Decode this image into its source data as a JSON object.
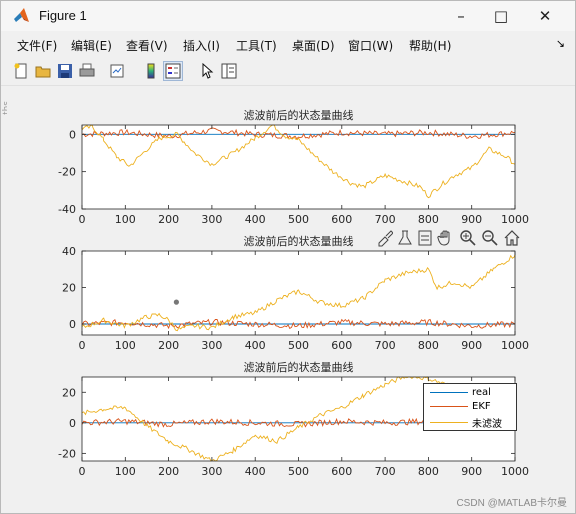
{
  "window": {
    "title": "Figure 1"
  },
  "menu": [
    "文件(F)",
    "编辑(E)",
    "查看(V)",
    "插入(I)",
    "工具(T)",
    "桌面(D)",
    "窗口(W)",
    "帮助(H)"
  ],
  "toolbar_icons": [
    "new-figure-icon",
    "open-folder-icon",
    "save-icon",
    "print-icon",
    "link-plot-icon",
    "insert-colorbar-icon",
    "insert-legend-icon",
    "pointer-icon",
    "property-inspector-icon"
  ],
  "axes_toolbar_icons": [
    "brush-icon",
    "data-tips-icon",
    "pan-hand-icon",
    "zoom-in-icon",
    "zoom-out-icon",
    "home-icon"
  ],
  "watermark": "CSDN @MATLAB卡尔曼",
  "side_fragment": "ths",
  "legend": {
    "entries": [
      "real",
      "EKF",
      "未滤波"
    ],
    "colors": [
      "#0072BD",
      "#D95319",
      "#EDB120"
    ]
  },
  "chart_data": [
    {
      "type": "line",
      "title": "滤波前后的状态量曲线",
      "xlim": [
        0,
        1000
      ],
      "ylim": [
        -40,
        5
      ],
      "xticks": [
        0,
        100,
        200,
        300,
        400,
        500,
        600,
        700,
        800,
        900,
        1000
      ],
      "yticks": [
        0,
        -20,
        -40
      ],
      "series": [
        {
          "name": "real",
          "color": "#0072BD",
          "x": [
            0,
            1000
          ],
          "y": [
            0,
            0
          ]
        },
        {
          "name": "EKF",
          "color": "#D95319",
          "x": [
            0,
            100,
            200,
            300,
            400,
            500,
            600,
            700,
            800,
            900,
            1000
          ],
          "y": [
            0,
            1,
            -1,
            2,
            0,
            -1,
            1,
            0,
            1,
            -1,
            1
          ]
        },
        {
          "name": "未滤波",
          "color": "#EDB120",
          "x": [
            0,
            25,
            50,
            80,
            110,
            150,
            180,
            220,
            260,
            300,
            350,
            400,
            440,
            470,
            500,
            540,
            580,
            620,
            650,
            700,
            740,
            780,
            800,
            830,
            860,
            900,
            940,
            980,
            1000
          ],
          "y": [
            3,
            4,
            -3,
            -12,
            -17,
            -8,
            -2,
            0,
            -10,
            -16,
            -10,
            -2,
            5,
            -1,
            -3,
            -12,
            -20,
            -26,
            -28,
            -22,
            -25,
            -28,
            -33,
            -27,
            -22,
            -18,
            -8,
            -12,
            -16
          ]
        }
      ]
    },
    {
      "type": "line",
      "title": "滤波前后的状态量曲线",
      "xlim": [
        0,
        1000
      ],
      "ylim": [
        -6,
        40
      ],
      "xticks": [
        0,
        100,
        200,
        300,
        400,
        500,
        600,
        700,
        800,
        900,
        1000
      ],
      "yticks": [
        40,
        20,
        0
      ],
      "series": [
        {
          "name": "real",
          "color": "#0072BD",
          "x": [
            0,
            1000
          ],
          "y": [
            0,
            0
          ]
        },
        {
          "name": "EKF",
          "color": "#D95319",
          "x": [
            0,
            100,
            200,
            300,
            400,
            500,
            600,
            700,
            800,
            900,
            1000
          ],
          "y": [
            0,
            1,
            -1,
            1,
            0,
            -1,
            1,
            0,
            1,
            -1,
            0
          ]
        },
        {
          "name": "未滤波",
          "color": "#EDB120",
          "x": [
            0,
            50,
            100,
            150,
            180,
            200,
            220,
            260,
            300,
            350,
            400,
            450,
            500,
            550,
            600,
            650,
            700,
            750,
            800,
            820,
            860,
            900,
            950,
            1000
          ],
          "y": [
            -2,
            2,
            -1,
            4,
            5,
            2,
            -3,
            -1,
            -2,
            4,
            6,
            13,
            18,
            12,
            10,
            14,
            24,
            28,
            30,
            20,
            23,
            20,
            30,
            38
          ]
        }
      ],
      "marker": {
        "x": 218,
        "y": 12
      }
    },
    {
      "type": "line",
      "title": "滤波前后的状态量曲线",
      "xlim": [
        0,
        1000
      ],
      "ylim": [
        -25,
        30
      ],
      "xticks": [
        0,
        100,
        200,
        300,
        400,
        500,
        600,
        700,
        800,
        900,
        1000
      ],
      "yticks": [
        20,
        0,
        -20
      ],
      "series": [
        {
          "name": "real",
          "color": "#0072BD",
          "x": [
            0,
            1000
          ],
          "y": [
            0,
            0
          ]
        },
        {
          "name": "EKF",
          "color": "#D95319",
          "x": [
            0,
            100,
            200,
            300,
            400,
            500,
            600,
            700,
            800,
            900,
            1000
          ],
          "y": [
            0,
            1,
            -1,
            1,
            0,
            -1,
            1,
            0,
            1,
            -1,
            0
          ]
        },
        {
          "name": "未滤波",
          "color": "#EDB120",
          "x": [
            0,
            50,
            100,
            150,
            200,
            250,
            300,
            350,
            400,
            450,
            500,
            550,
            600,
            650,
            700,
            750,
            800,
            850,
            900,
            950,
            1000
          ],
          "y": [
            6,
            9,
            10,
            -2,
            -12,
            -18,
            -25,
            -18,
            -8,
            -12,
            -3,
            5,
            10,
            18,
            25,
            31,
            29,
            24,
            20,
            22,
            19
          ]
        }
      ]
    }
  ]
}
